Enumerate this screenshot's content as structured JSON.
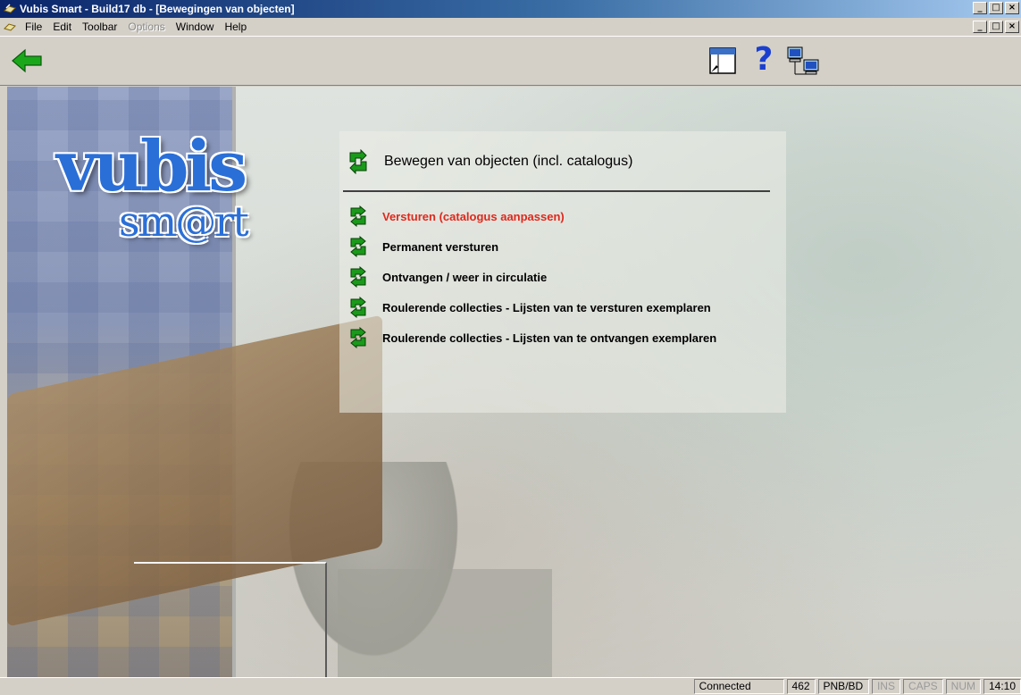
{
  "window": {
    "title": "Vubis Smart - Build17 db - [Bewegingen van objecten]",
    "controls": {
      "minimize": "_",
      "maximize": "□",
      "close": "×"
    }
  },
  "menubar": {
    "items": [
      {
        "label": "File",
        "enabled": true
      },
      {
        "label": "Edit",
        "enabled": true
      },
      {
        "label": "Toolbar",
        "enabled": true
      },
      {
        "label": "Options",
        "enabled": false
      },
      {
        "label": "Window",
        "enabled": true
      },
      {
        "label": "Help",
        "enabled": true
      }
    ]
  },
  "toolbar": {
    "help_glyph": "?",
    "icons": [
      "back-arrow-icon",
      "form-icon",
      "help-icon",
      "network-icon"
    ],
    "back_color": "#1aa81a"
  },
  "logo": {
    "line1": "vubis",
    "line2": "sm@rt",
    "color": "#2a6fd8"
  },
  "page": {
    "title": "Bewegen van objecten (incl. catalogus)",
    "options": [
      {
        "label": "Versturen (catalogus aanpassen)",
        "active": true
      },
      {
        "label": "Permanent versturen",
        "active": false
      },
      {
        "label": "Ontvangen / weer in circulatie",
        "active": false
      },
      {
        "label": "Roulerende collecties - Lijsten van te versturen exemplaren",
        "active": false
      },
      {
        "label": "Roulerende collecties - Lijsten van te ontvangen exemplaren",
        "active": false
      }
    ],
    "active_color": "#e0281c"
  },
  "statusbar": {
    "connection": "Connected",
    "count": "462",
    "location": "PNB/BD",
    "ins": "INS",
    "caps": "CAPS",
    "num": "NUM",
    "time": "14:10"
  }
}
